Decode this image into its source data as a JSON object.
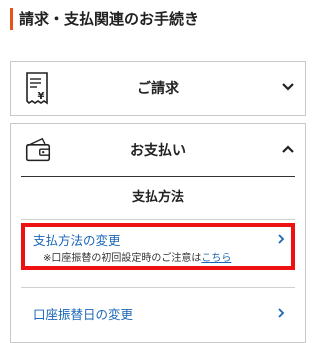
{
  "page_title": "請求・支払関連のお手続き",
  "accent_color": "#e8531a",
  "cards": {
    "billing": {
      "label": "ご請求",
      "icon": "invoice-yen-icon",
      "state": "collapsed"
    },
    "payment": {
      "label": "お支払い",
      "icon": "wallet-icon",
      "state": "expanded"
    }
  },
  "payment_section": {
    "heading": "支払方法",
    "items": [
      {
        "label": "支払方法の変更",
        "note_prefix": "※口座振替の初回設定時のご注意は",
        "note_link": "こちら",
        "highlighted": true,
        "highlight_color": "#ee1111"
      },
      {
        "label": "口座振替日の変更"
      }
    ]
  },
  "link_color": "#1a66b8"
}
